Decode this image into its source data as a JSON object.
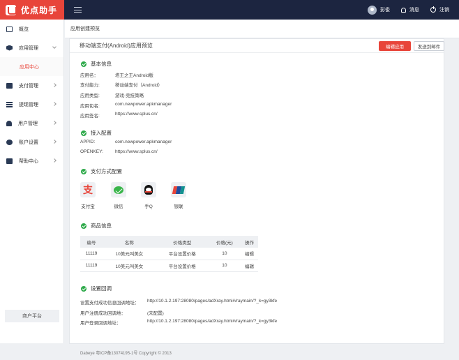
{
  "app": {
    "name": "优点助手"
  },
  "topbar": {
    "user_name": "彭俊",
    "messages_label": "消息",
    "logout_label": "注销"
  },
  "sidebar": {
    "items": [
      {
        "label": "概览",
        "icon": "dashboard-icon"
      },
      {
        "label": "应用管理",
        "icon": "cube-icon"
      },
      {
        "label": "支付管理",
        "icon": "card-icon"
      },
      {
        "label": "提现管理",
        "icon": "list-icon"
      },
      {
        "label": "用户管理",
        "icon": "user-icon"
      },
      {
        "label": "账户设置",
        "icon": "gear-icon"
      },
      {
        "label": "帮助中心",
        "icon": "book-icon"
      }
    ],
    "sub_item": "应用中心",
    "merchant_button": "商户平台"
  },
  "breadcrumb": "应用创建预览",
  "card": {
    "title": "移动端支付(Android)应用预览",
    "edit_button": "编辑应用",
    "email_button": "发送到邮件"
  },
  "basic": {
    "title": "基本信息",
    "rows": [
      {
        "k": "应用名：",
        "v": "塔王之王Android版"
      },
      {
        "k": "支付能力:",
        "v": "移动端支付（Android）"
      },
      {
        "k": "应用类型:",
        "v": "游戏-竞技策略"
      },
      {
        "k": "应用包名:",
        "v": "com.newpower.apkmanager"
      },
      {
        "k": "应用签名:",
        "v": "https://www.splus.cn/"
      }
    ]
  },
  "access": {
    "title": "接入配置",
    "rows": [
      {
        "k": "APPID:",
        "v": "com.newpower.apkmanager"
      },
      {
        "k": "OPENKEY:",
        "v": "https://www.splus.cn/"
      }
    ]
  },
  "payment": {
    "title": "支付方式配置",
    "methods": [
      {
        "label": "支付宝",
        "icon": "alipay-icon",
        "glyph": "支"
      },
      {
        "label": "微信",
        "icon": "wechat-icon"
      },
      {
        "label": "手Q",
        "icon": "qq-icon"
      },
      {
        "label": "银联",
        "icon": "unionpay-icon"
      }
    ]
  },
  "goods": {
    "title": "商品信息",
    "columns": [
      "编号",
      "名称",
      "价格类型",
      "价格(元)",
      "操作"
    ],
    "rows": [
      [
        "11119",
        "10美元叫美女",
        "平台设置价格",
        "10",
        "编辑"
      ],
      [
        "11119",
        "10美元叫美女",
        "平台设置价格",
        "10",
        "编辑"
      ]
    ]
  },
  "callback": {
    "title": "设置回调",
    "rows": [
      {
        "k": "设置支付成功信息回调地址：",
        "v": "http://10.1.2.197:28080/pages/adXray.html#/raymain/?_k=gy3kfe"
      },
      {
        "k": "用户注册成功回调地：",
        "v": "(未配置)"
      },
      {
        "k": "用户登录回调地址：",
        "v": "http://10.1.2.197:28080/pages/adXray.html#/raymain/?_k=gy3kfe"
      }
    ]
  },
  "footer": "Dabeye 粤ICP备13074195-1号 Copyright © 2013",
  "colors": {
    "brand": "#e8453a",
    "topbar": "#1c2540",
    "success": "#2faa4b"
  }
}
